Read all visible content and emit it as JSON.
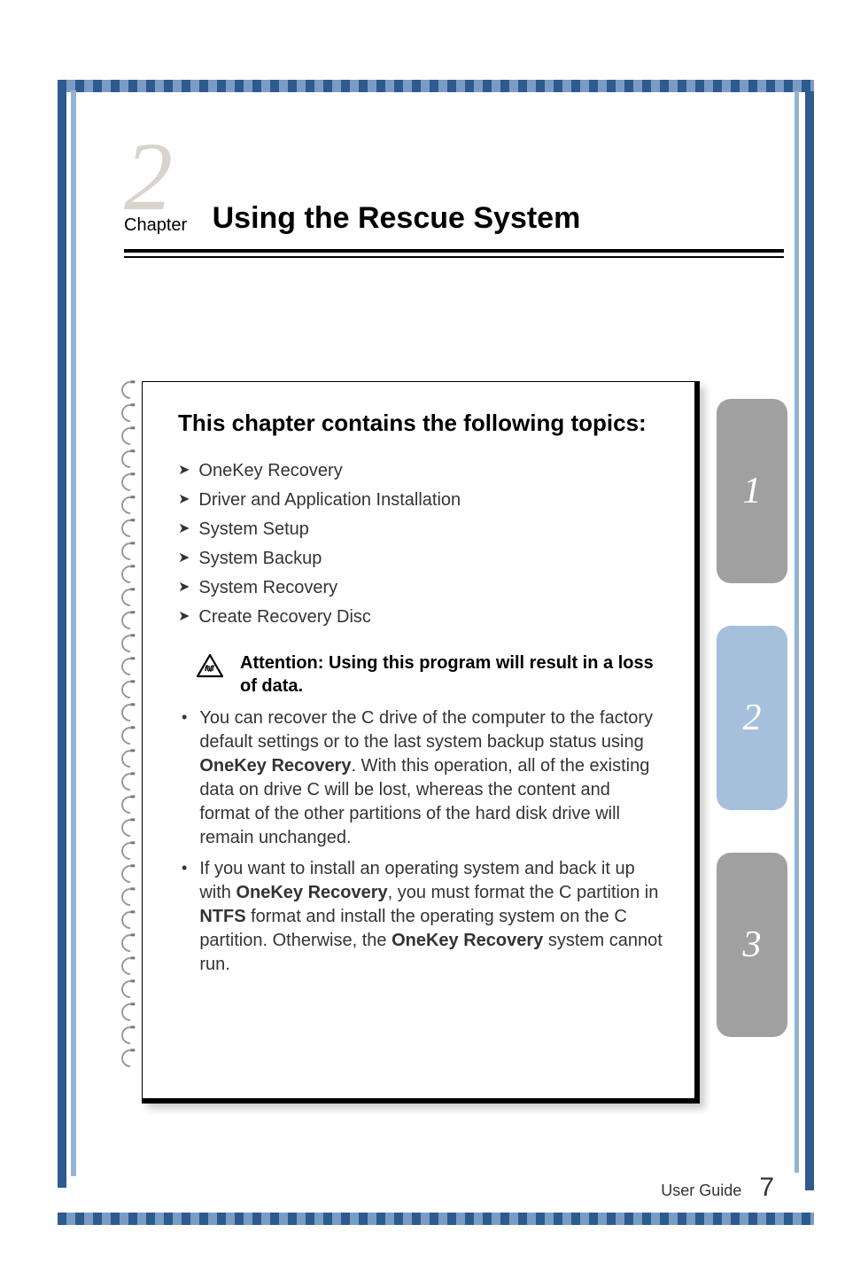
{
  "chapter": {
    "number": "2",
    "label": "Chapter",
    "title": "Using the Rescue System"
  },
  "section_heading": "This chapter contains the following topics:",
  "topics": [
    "OneKey Recovery",
    "Driver and Application Installation",
    "System Setup",
    "System Backup",
    "System Recovery",
    "Create Recovery Disc"
  ],
  "attention": {
    "label": "Attention: Using this program will result in a loss of data."
  },
  "bullets": [
    {
      "pre": "You can recover the C drive of the computer to the factory default settings or to the last system backup status using ",
      "bold1": "OneKey Recovery",
      "post": ". With this operation, all of the existing data on drive C will be lost, whereas the content and format of the other partitions of the hard disk drive will remain unchanged."
    },
    {
      "pre": "If you want to install an operating system and back it up with ",
      "bold1": "OneKey Recovery",
      "mid1": ", you must format the C partition in ",
      "bold2": "NTFS",
      "mid2": " format and install the operating system on the C partition. Otherwise, the ",
      "bold3": "OneKey Recovery",
      "post": " system cannot run."
    }
  ],
  "side_tabs": [
    "1",
    "2",
    "3"
  ],
  "footer": {
    "label": "User Guide",
    "page": "7"
  }
}
